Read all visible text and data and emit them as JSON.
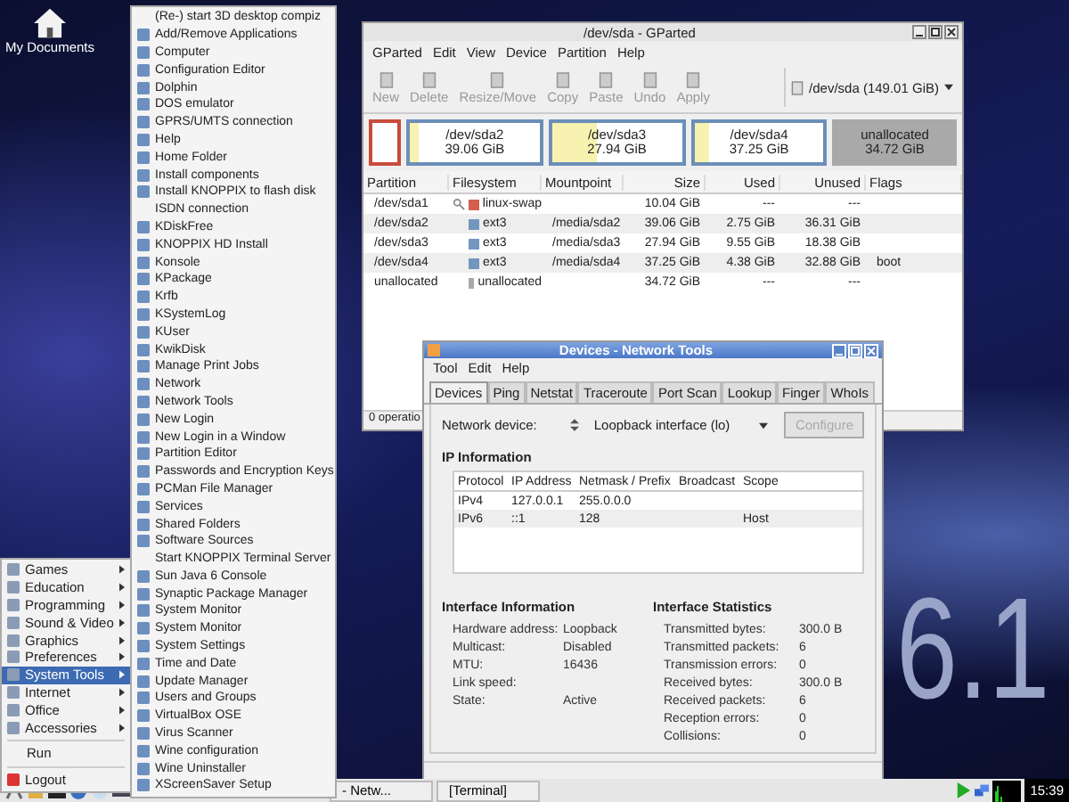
{
  "desktop": {
    "icons": [
      {
        "label": "My Documents"
      }
    ],
    "wallpaper_text": "6.1"
  },
  "gparted": {
    "title": "/dev/sda - GParted",
    "menu": [
      "GParted",
      "Edit",
      "View",
      "Device",
      "Partition",
      "Help"
    ],
    "toolbar": [
      {
        "label": "New",
        "disabled": true
      },
      {
        "label": "Delete",
        "disabled": true
      },
      {
        "label": "Resize/Move",
        "disabled": true
      },
      {
        "label": "Copy",
        "disabled": true
      },
      {
        "label": "Paste",
        "disabled": true
      },
      {
        "label": "Undo",
        "disabled": true
      },
      {
        "label": "Apply",
        "disabled": true
      }
    ],
    "device": "/dev/sda  (149.01 GiB)",
    "graph": [
      {
        "kind": "swap"
      },
      {
        "kind": "partition",
        "name": "/dev/sda2",
        "size": "39.06 GiB",
        "level": 0.07
      },
      {
        "kind": "partition",
        "name": "/dev/sda3",
        "size": "27.94 GiB",
        "level": 0.34
      },
      {
        "kind": "partition",
        "name": "/dev/sda4",
        "size": "37.25 GiB",
        "level": 0.12
      },
      {
        "kind": "unallocated",
        "name": "unallocated",
        "size": "34.72 GiB"
      }
    ],
    "columns": [
      "Partition",
      "Filesystem",
      "Mountpoint",
      "Size",
      "Used",
      "Unused",
      "Flags"
    ],
    "rows": [
      {
        "partition": "/dev/sda1",
        "locked": true,
        "filesystem": "linux-swap",
        "color": "#d35f4f",
        "mountpoint": "",
        "size": "10.04 GiB",
        "used": "---",
        "unused": "---",
        "flags": ""
      },
      {
        "partition": "/dev/sda2",
        "locked": false,
        "filesystem": "ext3",
        "color": "#7396bf",
        "mountpoint": "/media/sda2",
        "size": "39.06 GiB",
        "used": "2.75 GiB",
        "unused": "36.31 GiB",
        "flags": ""
      },
      {
        "partition": "/dev/sda3",
        "locked": false,
        "filesystem": "ext3",
        "color": "#7396bf",
        "mountpoint": "/media/sda3",
        "size": "27.94 GiB",
        "used": "9.55 GiB",
        "unused": "18.38 GiB",
        "flags": ""
      },
      {
        "partition": "/dev/sda4",
        "locked": false,
        "filesystem": "ext3",
        "color": "#7396bf",
        "mountpoint": "/media/sda4",
        "size": "37.25 GiB",
        "used": "4.38 GiB",
        "unused": "32.88 GiB",
        "flags": "boot"
      },
      {
        "partition": "unallocated",
        "locked": false,
        "filesystem": "unallocated",
        "color": "#a8a8a8",
        "mountpoint": "",
        "size": "34.72 GiB",
        "used": "---",
        "unused": "---",
        "flags": ""
      }
    ],
    "status": "0 operatio"
  },
  "network_tools": {
    "title": "Devices - Network Tools",
    "menu": [
      "Tool",
      "Edit",
      "Help"
    ],
    "tabs": [
      {
        "label": "Devices",
        "selected": true
      },
      {
        "label": "Ping",
        "selected": false
      },
      {
        "label": "Netstat",
        "selected": false
      },
      {
        "label": "Traceroute",
        "selected": false
      },
      {
        "label": "Port Scan",
        "selected": false
      },
      {
        "label": "Lookup",
        "selected": false
      },
      {
        "label": "Finger",
        "selected": false
      },
      {
        "label": "WhoIs",
        "selected": false
      }
    ],
    "device_label": "Network device:",
    "device_value": "Loopback interface (lo)",
    "configure": {
      "label": "Configure",
      "disabled": true
    },
    "ip_title": "IP Information",
    "ip_columns": [
      "Protocol",
      "IP Address",
      "Netmask / Prefix",
      "Broadcast",
      "Scope"
    ],
    "ip_rows": [
      [
        "IPv4",
        "127.0.0.1",
        "255.0.0.0",
        "",
        ""
      ],
      [
        "IPv6",
        "::1",
        "128",
        "",
        "Host"
      ]
    ],
    "info_title": "Interface Information",
    "info": [
      {
        "label": "Hardware address:",
        "value": "Loopback"
      },
      {
        "label": "Multicast:",
        "value": "Disabled"
      },
      {
        "label": "MTU:",
        "value": "16436"
      },
      {
        "label": "Link speed:"
      },
      {
        "label": "State:",
        "value": "Active"
      }
    ],
    "stats_title": "Interface Statistics",
    "stats": [
      {
        "label": "Transmitted bytes:",
        "value": "300.0 B"
      },
      {
        "label": "Transmitted packets:",
        "value": "6"
      },
      {
        "label": "Transmission errors:",
        "value": "0"
      },
      {
        "label": "Received bytes:",
        "value": "300.0 B"
      },
      {
        "label": "Received packets:",
        "value": "6"
      },
      {
        "label": "Reception errors:",
        "value": "0"
      },
      {
        "label": "Collisions:",
        "value": "0"
      }
    ]
  },
  "start_menu": {
    "items": [
      {
        "label": "Games",
        "kind": "submenu",
        "selected": false
      },
      {
        "label": "Education",
        "kind": "submenu",
        "selected": false
      },
      {
        "label": "Programming",
        "kind": "submenu",
        "selected": false
      },
      {
        "label": "Sound & Video",
        "kind": "submenu",
        "selected": false
      },
      {
        "label": "Graphics",
        "kind": "submenu",
        "selected": false
      },
      {
        "label": "Preferences",
        "kind": "submenu",
        "selected": false
      },
      {
        "label": "System Tools",
        "kind": "submenu",
        "selected": true
      },
      {
        "label": "Internet",
        "kind": "submenu",
        "selected": false
      },
      {
        "label": "Office",
        "kind": "submenu",
        "selected": false
      },
      {
        "label": "Accessories",
        "kind": "submenu",
        "selected": false
      },
      {
        "label": "Run",
        "kind": "plain",
        "selected": false
      },
      {
        "label": "Logout",
        "kind": "action",
        "selected": false
      }
    ],
    "submenu": [
      {
        "label": "(Re-) start 3D desktop compiz",
        "kind": "plain"
      },
      {
        "label": "Add/Remove Applications",
        "kind": "app"
      },
      {
        "label": "Computer",
        "kind": "app"
      },
      {
        "label": "Configuration Editor",
        "kind": "app"
      },
      {
        "label": "Dolphin",
        "kind": "app"
      },
      {
        "label": "DOS emulator",
        "kind": "app"
      },
      {
        "label": "GPRS/UMTS connection",
        "kind": "app"
      },
      {
        "label": "Help",
        "kind": "app"
      },
      {
        "label": "Home Folder",
        "kind": "app"
      },
      {
        "label": "Install components",
        "kind": "app"
      },
      {
        "label": "Install KNOPPIX to flash disk",
        "kind": "app"
      },
      {
        "label": "ISDN connection",
        "kind": "plain"
      },
      {
        "label": "KDiskFree",
        "kind": "app"
      },
      {
        "label": "KNOPPIX HD Install",
        "kind": "app"
      },
      {
        "label": "Konsole",
        "kind": "app"
      },
      {
        "label": "KPackage",
        "kind": "app"
      },
      {
        "label": "Krfb",
        "kind": "app"
      },
      {
        "label": "KSystemLog",
        "kind": "app"
      },
      {
        "label": "KUser",
        "kind": "app"
      },
      {
        "label": "KwikDisk",
        "kind": "app"
      },
      {
        "label": "Manage Print Jobs",
        "kind": "app"
      },
      {
        "label": "Network",
        "kind": "app"
      },
      {
        "label": "Network Tools",
        "kind": "app"
      },
      {
        "label": "New Login",
        "kind": "app"
      },
      {
        "label": "New Login in a Window",
        "kind": "app"
      },
      {
        "label": "Partition Editor",
        "kind": "app"
      },
      {
        "label": "Passwords and Encryption Keys",
        "kind": "app"
      },
      {
        "label": "PCMan File Manager",
        "kind": "app"
      },
      {
        "label": "Services",
        "kind": "app"
      },
      {
        "label": "Shared Folders",
        "kind": "app"
      },
      {
        "label": "Software Sources",
        "kind": "app"
      },
      {
        "label": "Start KNOPPIX Terminal Server",
        "kind": "plain"
      },
      {
        "label": "Sun Java 6 Console",
        "kind": "app"
      },
      {
        "label": "Synaptic Package Manager",
        "kind": "app"
      },
      {
        "label": "System Monitor",
        "kind": "app"
      },
      {
        "label": "System Monitor",
        "kind": "app"
      },
      {
        "label": "System Settings",
        "kind": "app"
      },
      {
        "label": "Time and Date",
        "kind": "app"
      },
      {
        "label": "Update Manager",
        "kind": "app"
      },
      {
        "label": "Users and Groups",
        "kind": "app"
      },
      {
        "label": "VirtualBox OSE",
        "kind": "app"
      },
      {
        "label": "Virus Scanner",
        "kind": "app"
      },
      {
        "label": "Wine configuration",
        "kind": "app"
      },
      {
        "label": "Wine Uninstaller",
        "kind": "app"
      },
      {
        "label": "XScreenSaver Setup",
        "kind": "app"
      }
    ]
  },
  "taskbar": {
    "tasks": [
      "- Netw...",
      "[Terminal]"
    ],
    "clock": "15:39"
  }
}
